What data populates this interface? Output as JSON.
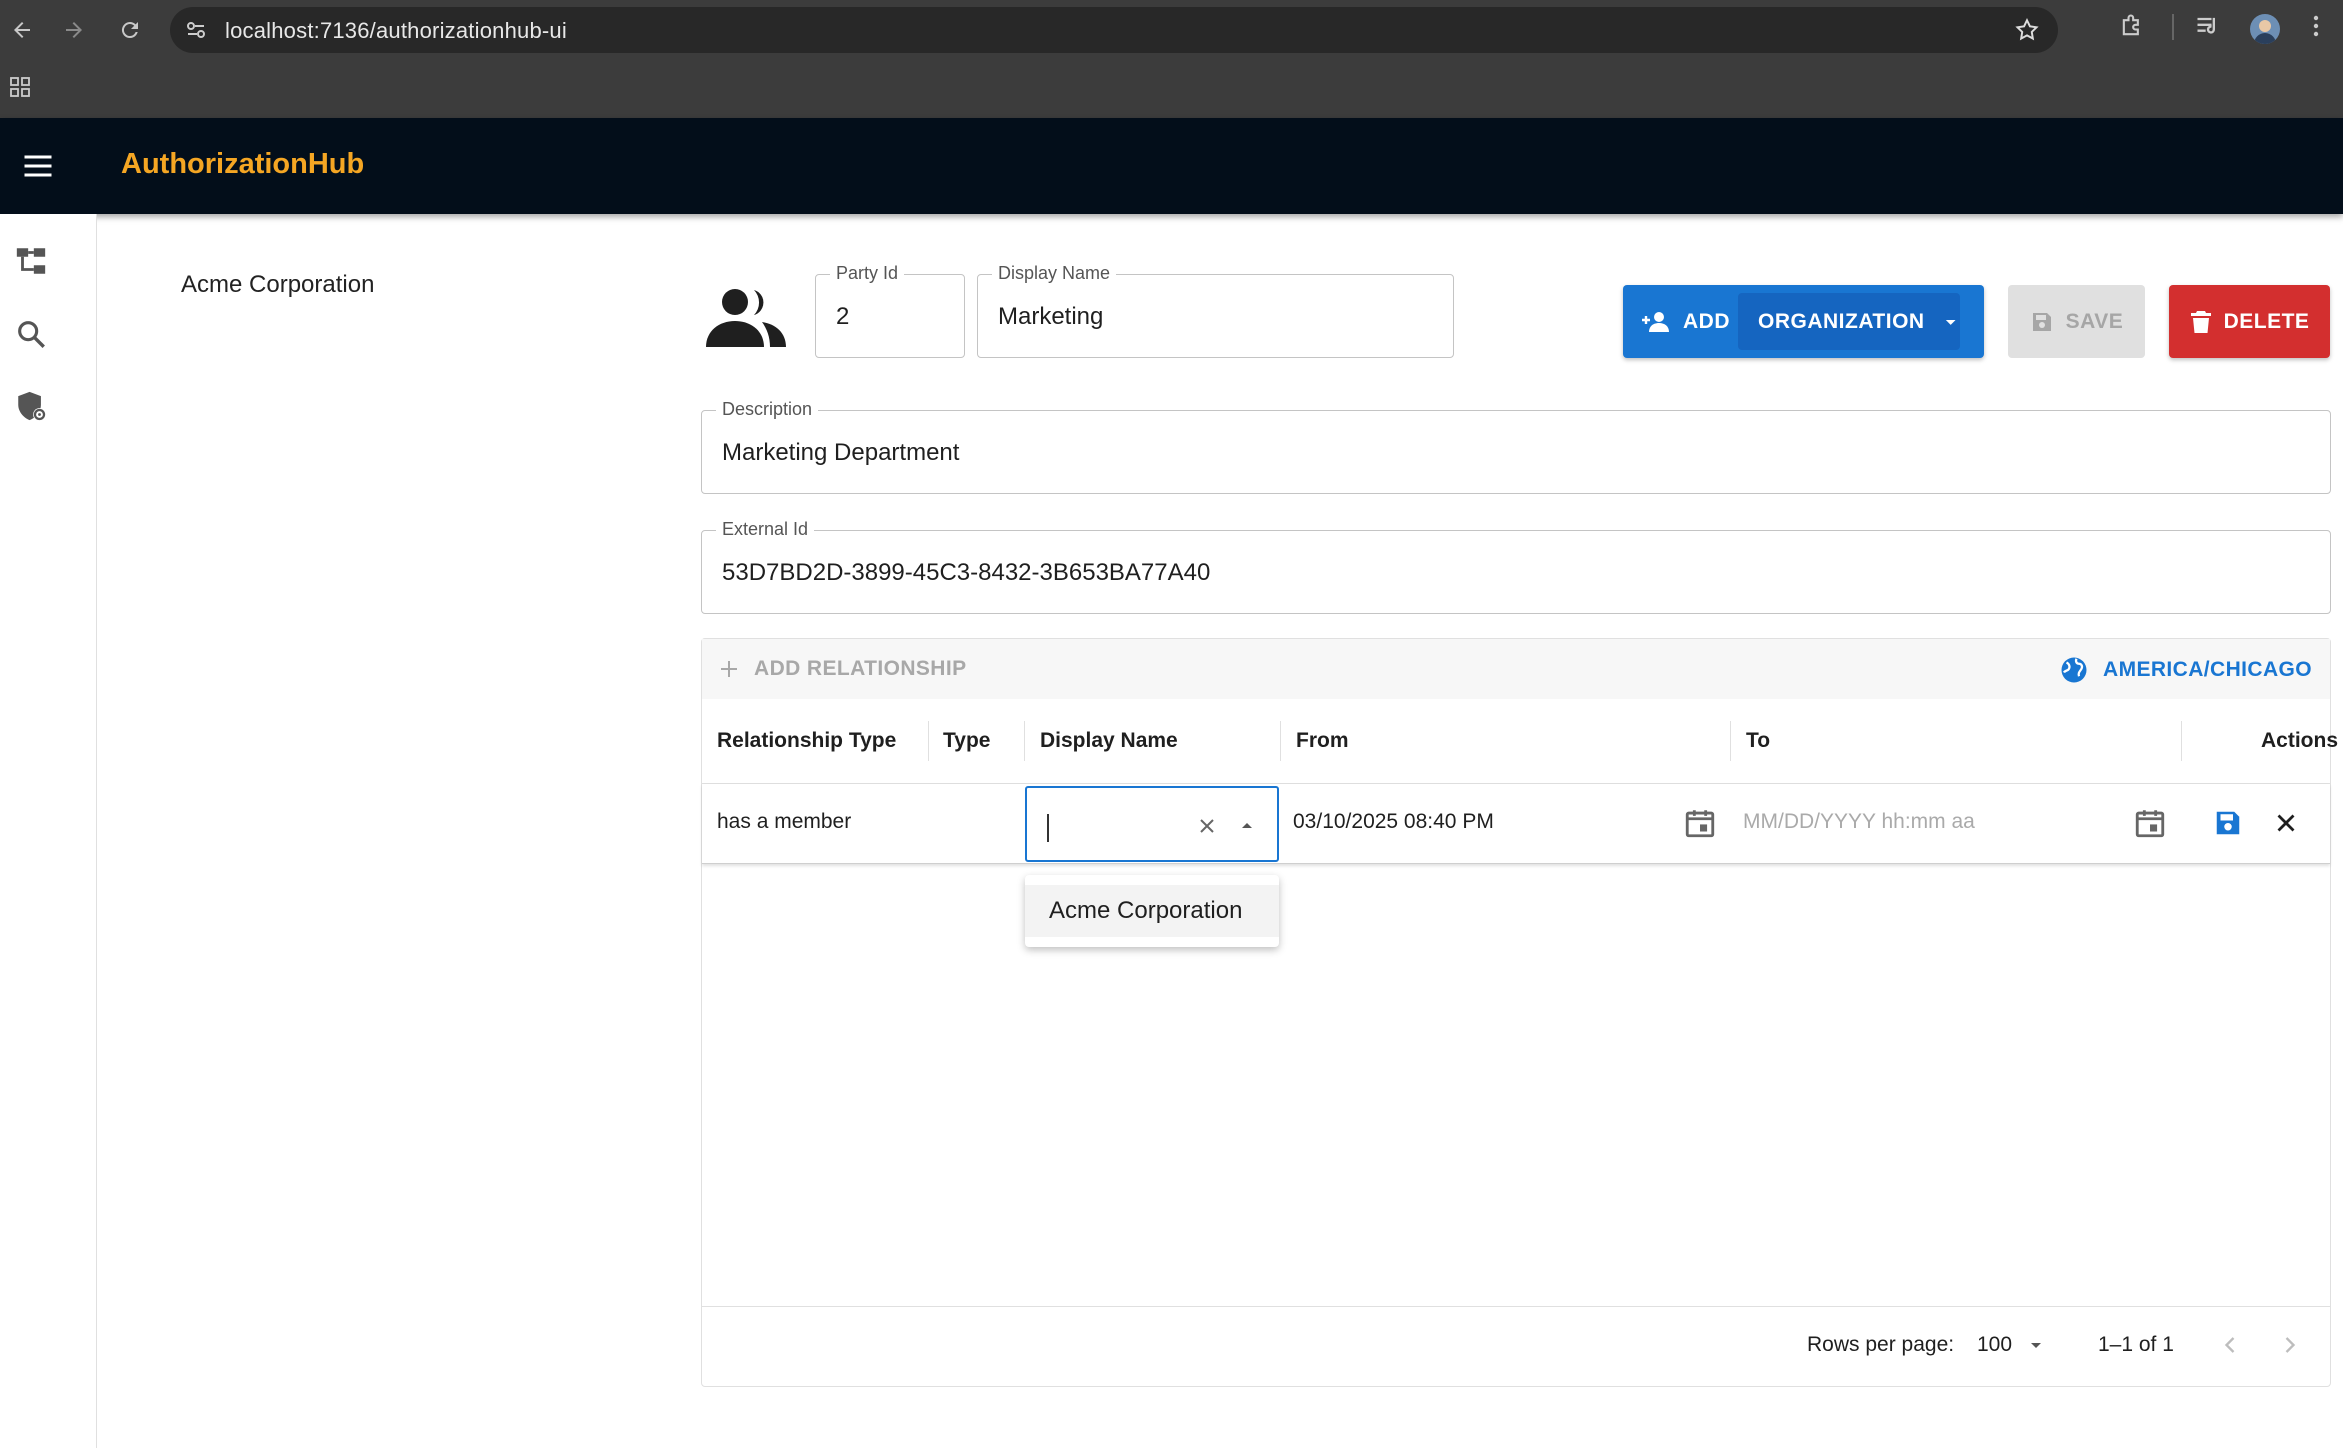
{
  "browser": {
    "url": "localhost:7136/authorizationhub-ui"
  },
  "app": {
    "title": "AuthorizationHub"
  },
  "tree": {
    "items": [
      {
        "label": "Acme Corporation"
      }
    ]
  },
  "form": {
    "party_id": {
      "label": "Party Id",
      "value": "2"
    },
    "display_name": {
      "label": "Display Name",
      "value": "Marketing"
    },
    "description": {
      "label": "Description",
      "value": "Marketing Department"
    },
    "external_id": {
      "label": "External Id",
      "value": "53D7BD2D-3899-45C3-8432-3B653BA77A40"
    }
  },
  "buttons": {
    "add": "ADD",
    "add_type": "ORGANIZATION",
    "save": "SAVE",
    "delete": "DELETE"
  },
  "grid": {
    "add_relationship": "ADD RELATIONSHIP",
    "timezone": "AMERICA/CHICAGO",
    "columns": [
      "Relationship Type",
      "Type",
      "Display Name",
      "From",
      "To",
      "Actions"
    ],
    "row": {
      "relationship_type": "has a member",
      "type": "",
      "display_name": "",
      "from": "03/10/2025 08:40 PM",
      "to_placeholder": "MM/DD/YYYY hh:mm aa"
    },
    "dropdown_options": [
      "Acme Corporation"
    ],
    "footer": {
      "rows_per_page_label": "Rows per page:",
      "rows_per_page": "100",
      "range": "1–1 of 1"
    }
  },
  "colors": {
    "accent": "#1976d2",
    "brand": "#f5a623",
    "danger": "#d32f2f",
    "appbar": "#030e1a"
  }
}
